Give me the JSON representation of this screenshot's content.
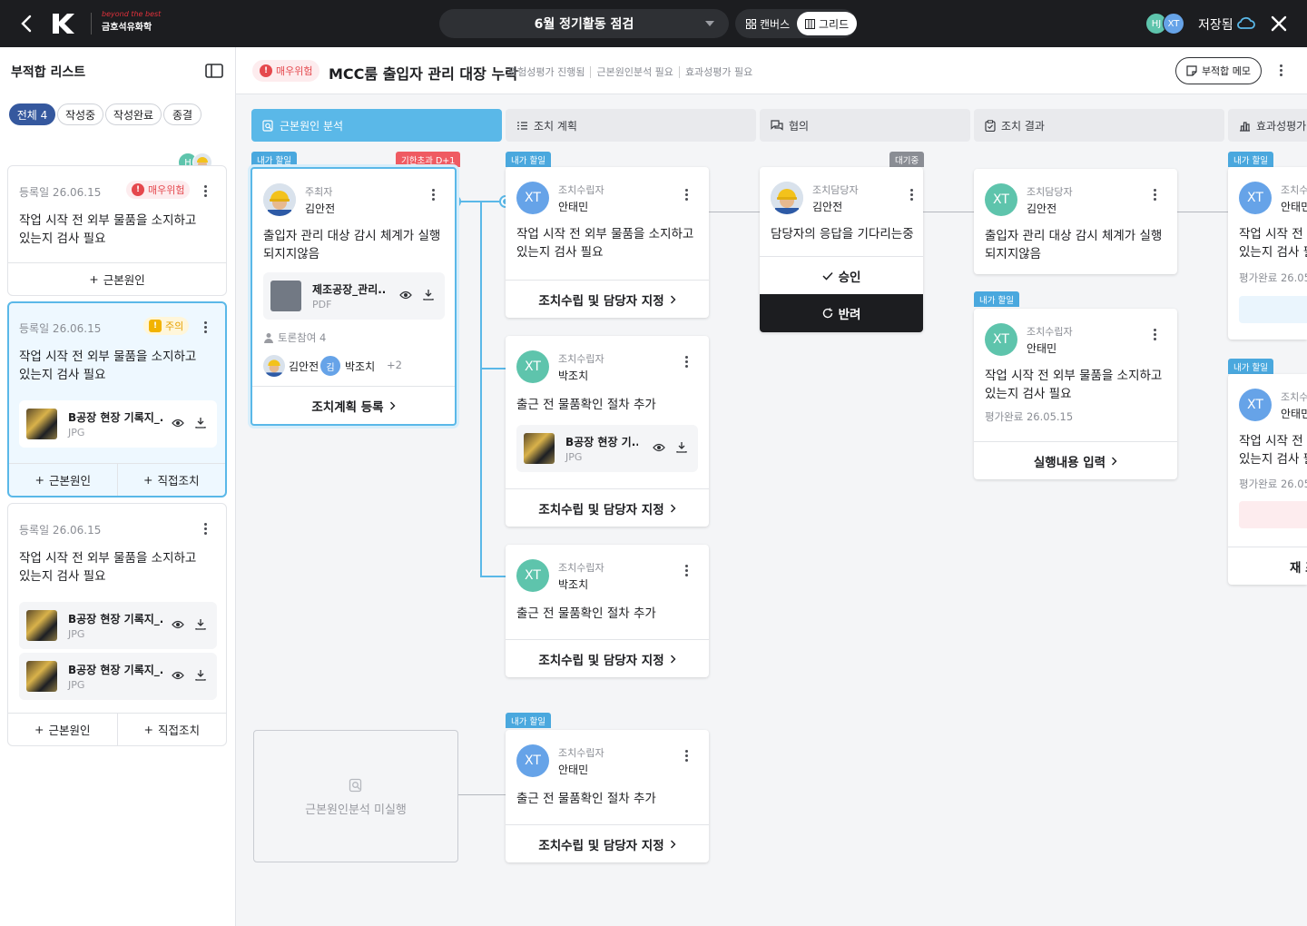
{
  "header": {
    "brand_tagline": "beyond the best",
    "brand_name": "금호석유화학",
    "session_title": "6월 정기활동 점검",
    "view_canvas": "캔버스",
    "view_grid": "그리드",
    "avatars": [
      "HJ",
      "XT"
    ],
    "saved_label": "저장됨"
  },
  "sidebar": {
    "title": "부적합 리스트",
    "filters": [
      "전체 4",
      "작성중",
      "작성완료",
      "종결"
    ],
    "avatar_initial": "H",
    "cards": [
      {
        "date": "등록일 26.06.15",
        "badge": "매우위험",
        "text": "작업 시작 전 외부 물품을 소지하고 있는지 검사 필요",
        "actions": [
          "근본원인"
        ]
      },
      {
        "date": "등록일 26.06.15",
        "badge": "주의",
        "text": "작업 시작 전 외부 물품을 소지하고 있는지 검사 필요",
        "files": [
          {
            "name": "B공장 현장 기록지_...",
            "type": "JPG"
          }
        ],
        "actions": [
          "근본원인",
          "직접조치"
        ]
      },
      {
        "date": "등록일 26.06.15",
        "text": "작업 시작 전 외부 물품을 소지하고 있는지 검사 필요",
        "files": [
          {
            "name": "B공장 현장 기록지_...",
            "type": "JPG"
          },
          {
            "name": "B공장 현장 기록지_...",
            "type": "JPG"
          }
        ],
        "actions": [
          "근본원인",
          "직접조치"
        ]
      }
    ]
  },
  "main": {
    "badge": "매우위험",
    "title": "MCC룸 출입자 관리 대장 누락",
    "tags": [
      "위험성평가 진행됨",
      "근본원인분석 필요",
      "효과성평가 필요"
    ],
    "memo_label": "부적합 메모",
    "columns": [
      "근본원인 분석",
      "조치 계획",
      "협의",
      "조치 결과",
      "효과성평가"
    ]
  },
  "cards": {
    "root": {
      "tag": "내가 할일",
      "overdue": "기한초과 D+1",
      "role": "주최자",
      "name": "김안전",
      "text": "출입자 관리 대상 감시 체계가 실행되지지않음",
      "file_name": "제조공장_관리...",
      "file_type": "PDF",
      "discussion": "토론참여 4",
      "p1": "김안전",
      "p2_initial": "김",
      "p2": "박조치",
      "more": "+2",
      "action": "조치계획 등록"
    },
    "plan1": {
      "tag": "내가 할일",
      "avatar": "XT",
      "role": "조치수립자",
      "name": "안태민",
      "text": "작업 시작 전 외부 물품을 소지하고 있는지 검사 필요",
      "action": "조치수립 및 담당자 지정"
    },
    "plan2": {
      "avatar": "XT",
      "role": "조치수립자",
      "name": "박조치",
      "text": "출근 전 물품확인 절차 추가",
      "file_name": "B공장 현장 기...",
      "file_type": "JPG",
      "action": "조치수립 및 담당자 지정"
    },
    "plan3": {
      "avatar": "XT",
      "role": "조치수립자",
      "name": "박조치",
      "text": "출근 전 물품확인 절차 추가",
      "action": "조치수립 및 담당자 지정"
    },
    "plan4": {
      "tag": "내가 할일",
      "avatar": "XT",
      "role": "조치수립자",
      "name": "안태민",
      "text": "출근 전 물품확인 절차 추가",
      "action": "조치수립 및 담당자 지정"
    },
    "consult": {
      "tag": "대기중",
      "role": "조치담당자",
      "name": "김안전",
      "text": "담당자의 응답을 기다리는중",
      "approve": "승인",
      "reject": "반려"
    },
    "result1": {
      "avatar": "XT",
      "role": "조치담당자",
      "name": "김안전",
      "text": "출입자 관리 대상 감시 체계가 실행되지지않음"
    },
    "result2": {
      "tag": "내가 할일",
      "avatar": "XT",
      "role": "조치수립자",
      "name": "안태민",
      "text": "작업 시작 전 외부 물품을 소지하고 있는지 검사 필요",
      "date": "평가완료 26.05.15",
      "action": "실행내용 입력"
    },
    "eff1": {
      "tag": "내가 할일",
      "avatar": "XT",
      "role": "조치수",
      "name": "안태민",
      "text": "작업 시작 전 외부 있는지 검사 필",
      "date": "평가완료 26.05"
    },
    "eff2": {
      "tag": "내가 할일",
      "avatar": "XT",
      "role": "조치수",
      "name": "안태민",
      "text": "작업 시작 전 외 있는지 검사 필",
      "date": "평가완료 26.05",
      "action": "재 조"
    }
  },
  "empty_label": "근본원인분석 미실행",
  "colors": {
    "accent": "#5ab8e8",
    "danger": "#e5484d",
    "warning": "#e6a100",
    "teal": "#5ec4ac"
  }
}
